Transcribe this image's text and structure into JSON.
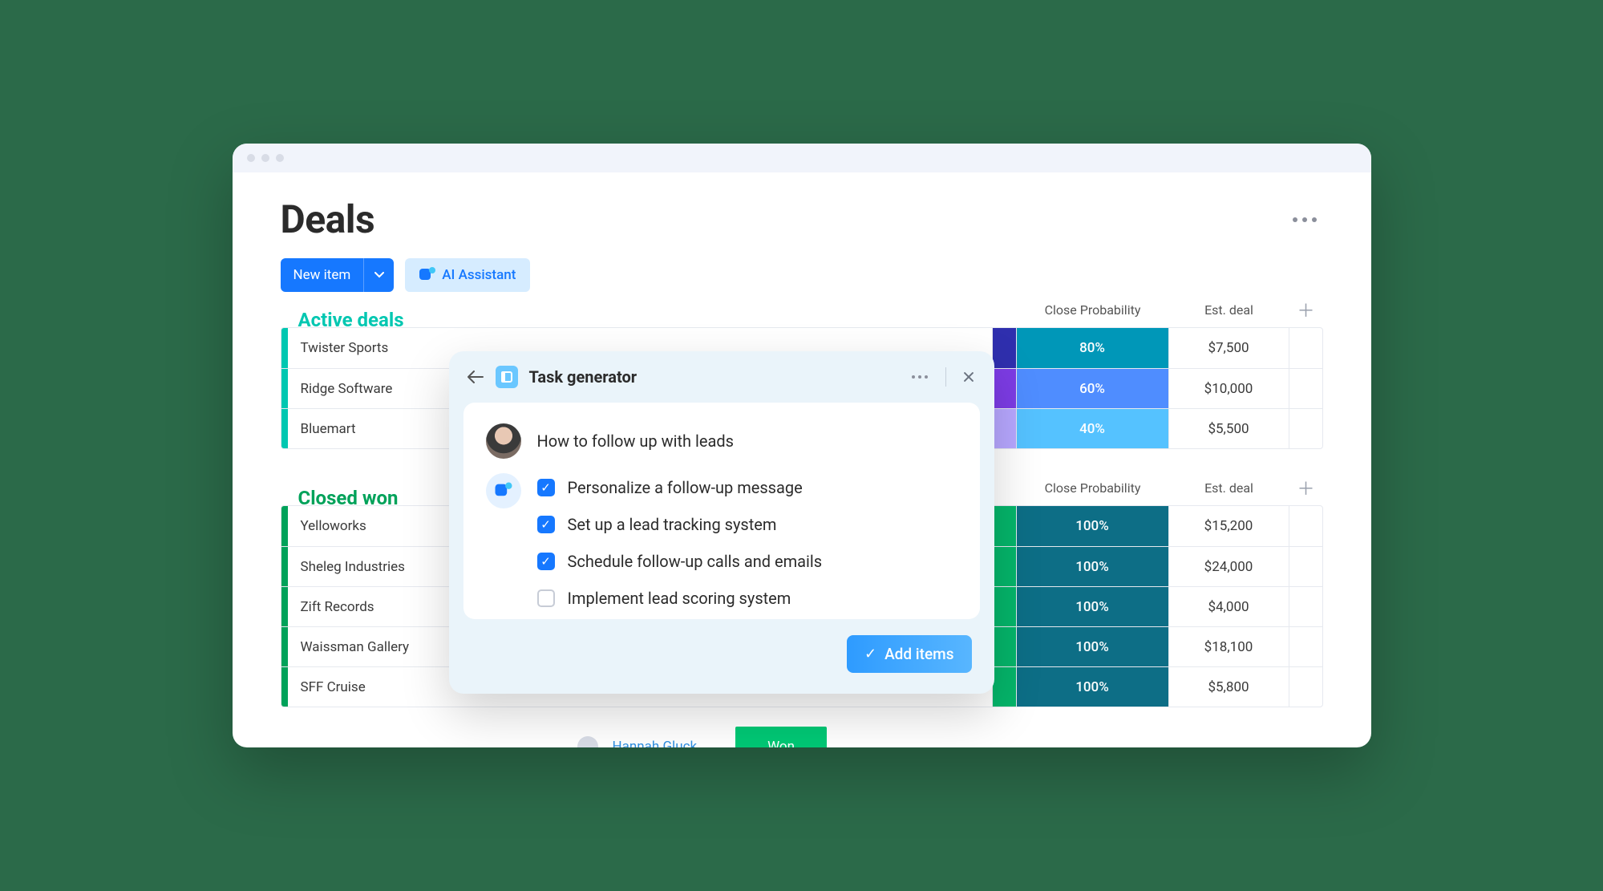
{
  "page": {
    "title": "Deals"
  },
  "toolbar": {
    "new_item_label": "New item",
    "ai_assistant_label": "AI Assistant"
  },
  "sections": {
    "active": {
      "title": "Active deals",
      "columns": {
        "prob": "Close Probability",
        "est": "Est. deal"
      },
      "rows": [
        {
          "name": "Twister Sports",
          "strip": "#2f2fae",
          "prob_bg": "#0097b8",
          "prob": "80%",
          "est": "$7,500"
        },
        {
          "name": "Ridge Software",
          "strip": "#7d3ce5",
          "prob_bg": "#4f8dff",
          "prob": "60%",
          "est": "$10,000"
        },
        {
          "name": "Bluemart",
          "strip": "#b7a7ff",
          "prob_bg": "#55c2ff",
          "prob": "40%",
          "est": "$5,500"
        }
      ]
    },
    "closed": {
      "title": "Closed won",
      "columns": {
        "prob": "Close Probability",
        "est": "Est. deal"
      },
      "rows": [
        {
          "name": "Yelloworks",
          "strip": "#05b56a",
          "prob_bg": "#0d6e86",
          "prob": "100%",
          "est": "$15,200"
        },
        {
          "name": "Sheleg Industries",
          "strip": "#05b56a",
          "prob_bg": "#0d6e86",
          "prob": "100%",
          "est": "$24,000"
        },
        {
          "name": "Zift Records",
          "strip": "#05b56a",
          "prob_bg": "#0d6e86",
          "prob": "100%",
          "est": "$4,000"
        },
        {
          "name": "Waissman Gallery",
          "strip": "#05b56a",
          "prob_bg": "#0d6e86",
          "prob": "100%",
          "est": "$18,100"
        },
        {
          "name": "SFF Cruise",
          "strip": "#05b56a",
          "prob_bg": "#0d6e86",
          "prob": "100%",
          "est": "$5,800"
        }
      ],
      "peek": {
        "contact": "Hannah Gluck",
        "status": "Won"
      }
    }
  },
  "panel": {
    "title": "Task generator",
    "prompt": "How to follow up with leads",
    "tasks": [
      {
        "label": "Personalize a follow-up message",
        "checked": true
      },
      {
        "label": "Set up a lead tracking system",
        "checked": true
      },
      {
        "label": "Schedule follow-up calls and emails",
        "checked": true
      },
      {
        "label": "Implement lead scoring system",
        "checked": false
      }
    ],
    "add_items_label": "Add items"
  }
}
